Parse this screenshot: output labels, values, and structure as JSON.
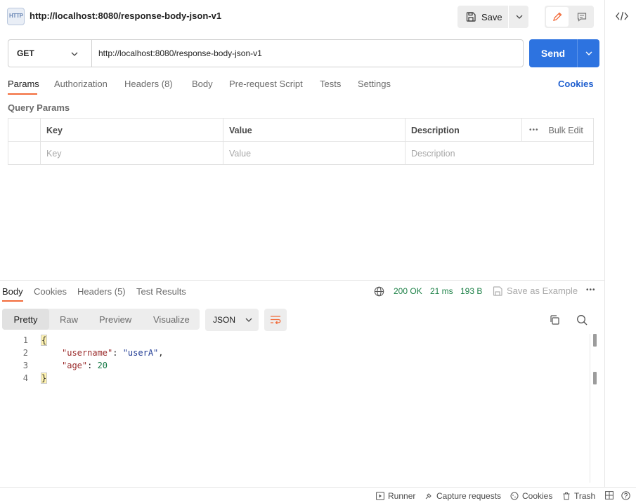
{
  "request": {
    "title": "http://localhost:8080/response-body-json-v1",
    "method": "GET",
    "url": "http://localhost:8080/response-body-json-v1"
  },
  "header": {
    "http_badge": "HTTP",
    "save_label": "Save"
  },
  "send_label": "Send",
  "request_tabs": [
    "Params",
    "Authorization",
    "Headers (8)",
    "Body",
    "Pre-request Script",
    "Tests",
    "Settings"
  ],
  "cookies_label": "Cookies",
  "query_params": {
    "title": "Query Params",
    "columns": [
      "Key",
      "Value",
      "Description"
    ],
    "bulk_edit": "Bulk Edit",
    "more": "•••",
    "placeholders": [
      "Key",
      "Value",
      "Description"
    ]
  },
  "response": {
    "tabs": [
      "Body",
      "Cookies",
      "Headers (5)",
      "Test Results"
    ],
    "status": "200 OK",
    "time": "21 ms",
    "size": "193 B",
    "save_example": "Save as Example",
    "more": "•••",
    "view_modes": [
      "Pretty",
      "Raw",
      "Preview",
      "Visualize"
    ],
    "format": "JSON",
    "code": {
      "line_numbers": [
        "1",
        "2",
        "3",
        "4"
      ],
      "open_brace": "{",
      "close_brace": "}",
      "key1": "\"username\"",
      "val1": "\"userA\"",
      "key2": "\"age\"",
      "val2": "20"
    }
  },
  "footer": {
    "runner": "Runner",
    "capture": "Capture requests",
    "cookies": "Cookies",
    "trash": "Trash"
  },
  "colors": {
    "accent": "#f26b3a",
    "send": "#2d73e0",
    "link": "#1f5fcf",
    "status_ok": "#1d8147"
  }
}
